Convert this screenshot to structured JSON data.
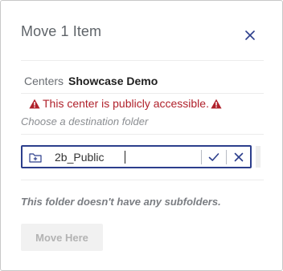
{
  "dialog": {
    "title": "Move 1 Item",
    "close_icon": "close-icon"
  },
  "breadcrumb": {
    "root": "Centers",
    "current": "Showcase Demo"
  },
  "warning": {
    "text": "This center is publicly accessible.",
    "icon": "warning-triangle-icon",
    "color": "#b0212b"
  },
  "hint": "Choose a destination folder",
  "folder_edit": {
    "value": "2b_Public",
    "folder_icon": "folder-plus-icon",
    "confirm_icon": "check-icon",
    "cancel_icon": "close-icon",
    "accent": "#2c3e8c"
  },
  "empty_message": "This folder doesn't have any subfolders.",
  "actions": {
    "move_here_label": "Move Here"
  }
}
